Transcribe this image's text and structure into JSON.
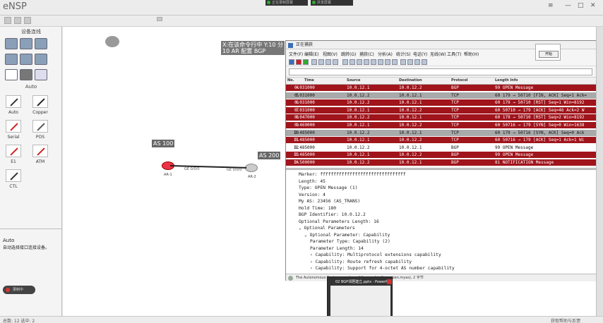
{
  "app": {
    "title": "eNSP",
    "rec_tab1": "正在录制屏幕",
    "rec_tab2": "共享屏幕"
  },
  "left_panel": {
    "title": "设备连线",
    "category": "Auto",
    "cables": [
      "Auto",
      "Copper",
      "Serial",
      "POS",
      "E1",
      "ATM",
      "CTL"
    ],
    "description_title": "Auto",
    "description_text": "自动选择接口连接设备。",
    "recording_badge": "录制中"
  },
  "canvas": {
    "annotation_line1": "X:在该命令行中 Y:10 分",
    "annotation_line2": "10 AR 配置 BGP",
    "as_label": "AS 100",
    "as_label2": "AS 200",
    "router1": "AR-1",
    "router2": "AR-2",
    "port1": "GE 0/0/0",
    "port2": "GE 0/0/0"
  },
  "capture": {
    "title": "正在捕获",
    "menu": [
      "文件(F)",
      "编辑(E)",
      "视图(V)",
      "跳转(G)",
      "捕获(C)",
      "分析(A)",
      "统计(S)",
      "电话(Y)",
      "无线(W)",
      "工具(T)",
      "帮助(H)"
    ],
    "columns": [
      "No.",
      "Time",
      "Source",
      "Destination",
      "Protocol",
      "Length Info"
    ],
    "packets": [
      {
        "no": "4",
        "time": "0.031000",
        "src": "10.0.12.1",
        "dst": "10.0.12.2",
        "proto": "BGP",
        "info": "99 OPEN Message",
        "style": "red"
      },
      {
        "no": "5",
        "time": "0.031000",
        "src": "10.0.12.2",
        "dst": "10.0.12.1",
        "proto": "TCP",
        "info": "60 179 → 50710 [FIN, ACK] Seq=1 Ack=",
        "style": "gray"
      },
      {
        "no": "6",
        "time": "0.031000",
        "src": "10.0.12.2",
        "dst": "10.0.12.1",
        "proto": "TCP",
        "info": "60 179 → 50710 [RST] Seq=1 Win=8192",
        "style": "red"
      },
      {
        "no": "7",
        "time": "0.031000",
        "src": "10.0.12.1",
        "dst": "10.0.12.2",
        "proto": "TCP",
        "info": "60 50710 → 179 [ACK] Seq=46 Ack=2 W",
        "style": "red"
      },
      {
        "no": "8",
        "time": "0.047000",
        "src": "10.0.12.2",
        "dst": "10.0.12.1",
        "proto": "TCP",
        "info": "60 179 → 50710 [RST] Seq=2 Win=8192",
        "style": "red"
      },
      {
        "no": "9",
        "time": "0.469000",
        "src": "10.0.12.1",
        "dst": "10.0.12.2",
        "proto": "TCP",
        "info": "60 50716 → 179 [SYN] Seq=0 Win=1638",
        "style": "red"
      },
      {
        "no": "10",
        "time": "0.485000",
        "src": "10.0.12.2",
        "dst": "10.0.12.1",
        "proto": "TCP",
        "info": "60 179 → 50716 [SYN, ACK] Seq=0 Ack",
        "style": "gray"
      },
      {
        "no": "11",
        "time": "0.485000",
        "src": "10.0.12.1",
        "dst": "10.0.12.2",
        "proto": "TCP",
        "info": "60 50716 → 179 [ACK] Seq=1 Ack=1 Wi",
        "style": "red"
      },
      {
        "no": "12",
        "time": "0.485000",
        "src": "10.0.12.2",
        "dst": "10.0.12.1",
        "proto": "BGP",
        "info": "99 OPEN Message",
        "style": "selected"
      },
      {
        "no": "13",
        "time": "0.485000",
        "src": "10.0.12.1",
        "dst": "10.0.12.2",
        "proto": "BGP",
        "info": "99 OPEN Message",
        "style": "red"
      },
      {
        "no": "14",
        "time": "0.500000",
        "src": "10.0.12.2",
        "dst": "10.0.12.1",
        "proto": "BGP",
        "info": "81 NOTIFICATION Message",
        "style": "red"
      }
    ],
    "details": [
      {
        "indent": 0,
        "text": "Marker: ffffffffffffffffffffffffffffffff"
      },
      {
        "indent": 0,
        "text": "Length: 45"
      },
      {
        "indent": 0,
        "text": "Type: OPEN Message (1)"
      },
      {
        "indent": 0,
        "text": "Version: 4"
      },
      {
        "indent": 0,
        "text": "My AS: 23456 (AS_TRANS)"
      },
      {
        "indent": 0,
        "text": "Hold Time: 180"
      },
      {
        "indent": 0,
        "text": "BGP Identifier: 10.0.12.2"
      },
      {
        "indent": 0,
        "text": "Optional Parameters Length: 16"
      },
      {
        "indent": 0,
        "text": "⌄ Optional Parameters"
      },
      {
        "indent": 1,
        "text": "⌄ Optional Parameter: Capability"
      },
      {
        "indent": 2,
        "text": "Parameter Type: Capability (2)"
      },
      {
        "indent": 2,
        "text": "Parameter Length: 14"
      },
      {
        "indent": 2,
        "text": "› Capability: Multiprotocol extensions capability"
      },
      {
        "indent": 2,
        "text": "› Capability: Route refresh capability"
      },
      {
        "indent": 2,
        "text": "› Capability: Support for 4-octet AS number capability"
      }
    ],
    "status": "The Autonomous System number of the sender (bgp.open.myas), 2 字节",
    "side_button": "开始"
  },
  "preview": {
    "title": "02 BGP邻居建立.pptx - PowerPoint"
  },
  "statusbar": {
    "left": "总数: 12 选中: 2",
    "right": "获取帮助与反馈"
  },
  "colors": {
    "row_red": "#a0141b",
    "row_gray": "#a9a9a9",
    "row_selected": "#ffffff",
    "accent": "#e34"
  }
}
